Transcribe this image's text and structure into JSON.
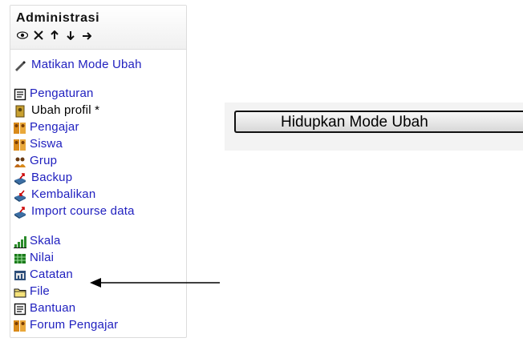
{
  "admin_block": {
    "title": "Administrasi",
    "controls": [
      {
        "icon": "eye-icon",
        "glyph": "👁"
      },
      {
        "icon": "close-icon",
        "glyph": "✕"
      },
      {
        "icon": "arrow-up-icon",
        "glyph": "↑"
      },
      {
        "icon": "arrow-down-icon",
        "glyph": "↓"
      },
      {
        "icon": "arrow-right-icon",
        "glyph": "→"
      }
    ],
    "items": [
      {
        "label": "Matikan Mode Ubah",
        "icon": "pencil-icon"
      },
      {
        "label": "Pengaturan",
        "icon": "document-icon"
      },
      {
        "label": "Ubah profil *",
        "icon": "profile-icon"
      },
      {
        "label": "Pengajar",
        "icon": "users-icon"
      },
      {
        "label": "Siswa",
        "icon": "users-icon"
      },
      {
        "label": "Grup",
        "icon": "group-icon"
      },
      {
        "label": "Backup",
        "icon": "backup-icon"
      },
      {
        "label": "Kembalikan",
        "icon": "restore-icon"
      },
      {
        "label": "Import course data",
        "icon": "import-icon"
      },
      {
        "label": "Skala",
        "icon": "scale-icon"
      },
      {
        "label": "Nilai",
        "icon": "grades-icon"
      },
      {
        "label": "Catatan",
        "icon": "logs-icon"
      },
      {
        "label": "File",
        "icon": "folder-icon"
      },
      {
        "label": "Bantuan",
        "icon": "help-icon"
      },
      {
        "label": "Forum Pengajar",
        "icon": "forum-icon"
      }
    ]
  },
  "mode_button": {
    "label": "Hidupkan Mode Ubah"
  },
  "colors": {
    "link": "#1f1fbf",
    "folder": "#f5e27a"
  }
}
